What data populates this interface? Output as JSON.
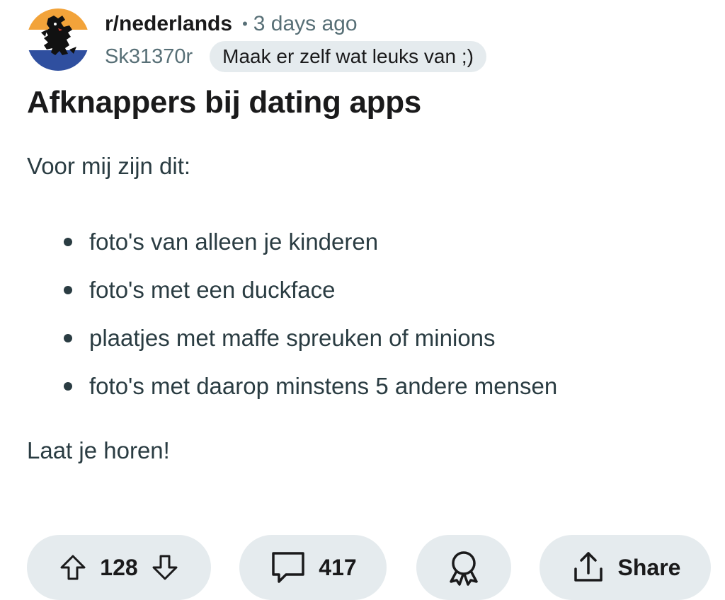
{
  "post": {
    "subreddit": "r/nederlands",
    "separator": "•",
    "time_ago": "3 days ago",
    "author": "Sk31370r",
    "flair": "Maak er zelf wat leuks van ;)",
    "title": "Afknappers bij dating apps",
    "intro": "Voor mij zijn dit:",
    "bullets": [
      "foto's van alleen je kinderen",
      "foto's met een duckface",
      "plaatjes met maffe spreuken of minions",
      "foto's met daarop minstens 5 andere mensen"
    ],
    "outro": "Laat je horen!"
  },
  "actions": {
    "upvote_icon": "arrow-up-icon",
    "vote_count": "128",
    "downvote_icon": "arrow-down-icon",
    "comment_icon": "comment-bubble-icon",
    "comment_count": "417",
    "award_icon": "award-ribbon-icon",
    "share_icon": "share-upload-icon",
    "share_label": "Share"
  },
  "colors": {
    "pill_bg": "#e5ebee",
    "muted_text": "#576f76",
    "body_text": "#2a3c42",
    "avatar_orange": "#f2a33a",
    "avatar_blue": "#2f4f9f"
  }
}
